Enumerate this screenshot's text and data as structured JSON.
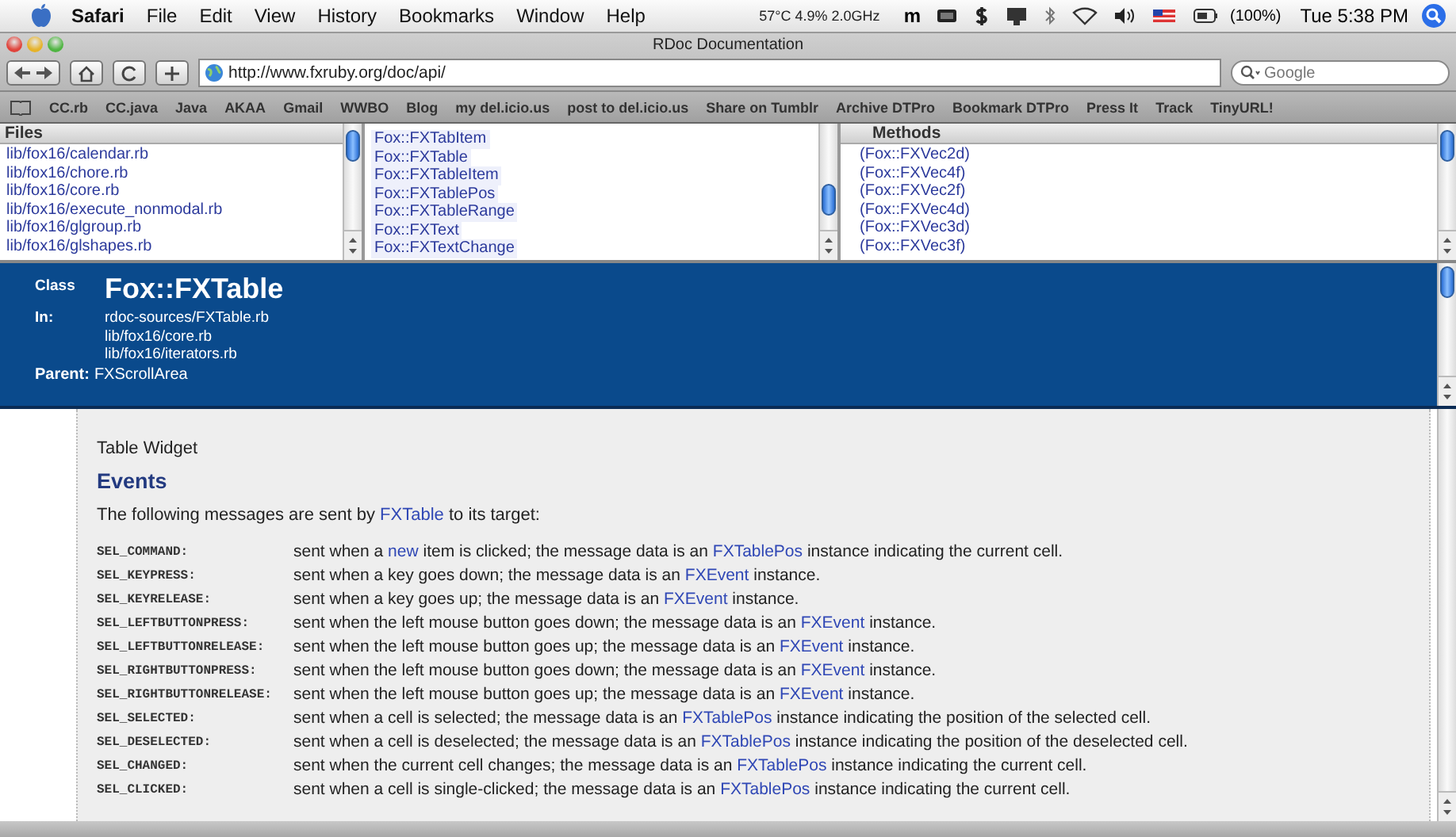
{
  "menubar": {
    "app": "Safari",
    "menus": [
      "File",
      "Edit",
      "View",
      "History",
      "Bookmarks",
      "Window",
      "Help"
    ],
    "status": "57°C 4.9% 2.0GHz",
    "status_letter": "m",
    "battery": "(100%)",
    "clock": "Tue 5:38 PM"
  },
  "window": {
    "title": "RDoc Documentation"
  },
  "toolbar": {
    "url": "http://www.fxruby.org/doc/api/",
    "search": {
      "placeholder": "Google"
    }
  },
  "bookmarks": [
    "CC.rb",
    "CC.java",
    "Java",
    "AKAA",
    "Gmail",
    "WWBO",
    "Blog",
    "my del.icio.us",
    "post to del.icio.us",
    "Share on Tumblr",
    "Archive DTPro",
    "Bookmark DTPro",
    "Press It",
    "Track",
    "TinyURL!"
  ],
  "files": {
    "title": "Files",
    "items": [
      "lib/fox16/calendar.rb",
      "lib/fox16/chore.rb",
      "lib/fox16/core.rb",
      "lib/fox16/execute_nonmodal.rb",
      "lib/fox16/glgroup.rb",
      "lib/fox16/glshapes.rb"
    ]
  },
  "classes": {
    "items": [
      "Fox::FXTabItem",
      "Fox::FXTable",
      "Fox::FXTableItem",
      "Fox::FXTablePos",
      "Fox::FXTableRange",
      "Fox::FXText",
      "Fox::FXTextChange"
    ]
  },
  "methods": {
    "title": "Methods",
    "items": [
      "(Fox::FXVec2d)",
      "(Fox::FXVec4f)",
      "(Fox::FXVec2f)",
      "(Fox::FXVec4d)",
      "(Fox::FXVec3d)",
      "(Fox::FXVec3f)"
    ]
  },
  "class_header": {
    "label": "Class",
    "name": "Fox::FXTable",
    "in_label": "In:",
    "in_files": [
      "rdoc-sources/FXTable.rb",
      "lib/fox16/core.rb",
      "lib/fox16/iterators.rb"
    ],
    "parent_label": "Parent:",
    "parent": "FXScrollArea"
  },
  "content": {
    "description": "Table Widget",
    "heading": "Events",
    "intro": [
      {
        "kind": "text",
        "text": "The following messages are sent by "
      },
      {
        "kind": "link",
        "text": "FXTable"
      },
      {
        "kind": "text",
        "text": " to its target:"
      }
    ],
    "events": [
      {
        "name": "SEL_COMMAND:",
        "description": [
          {
            "kind": "text",
            "text": "sent when a "
          },
          {
            "kind": "link",
            "text": "new"
          },
          {
            "kind": "text",
            "text": " item is clicked; the message data is an "
          },
          {
            "kind": "link",
            "text": "FXTablePos"
          },
          {
            "kind": "text",
            "text": " instance indicating the current cell."
          }
        ]
      },
      {
        "name": "SEL_KEYPRESS:",
        "description": [
          {
            "kind": "text",
            "text": "sent when a key goes down; the message data is an "
          },
          {
            "kind": "link",
            "text": "FXEvent"
          },
          {
            "kind": "text",
            "text": " instance."
          }
        ]
      },
      {
        "name": "SEL_KEYRELEASE:",
        "description": [
          {
            "kind": "text",
            "text": "sent when a key goes up; the message data is an "
          },
          {
            "kind": "link",
            "text": "FXEvent"
          },
          {
            "kind": "text",
            "text": " instance."
          }
        ]
      },
      {
        "name": "SEL_LEFTBUTTONPRESS:",
        "description": [
          {
            "kind": "text",
            "text": "sent when the left mouse button goes down; the message data is an "
          },
          {
            "kind": "link",
            "text": "FXEvent"
          },
          {
            "kind": "text",
            "text": " instance."
          }
        ]
      },
      {
        "name": "SEL_LEFTBUTTONRELEASE:",
        "description": [
          {
            "kind": "text",
            "text": "sent when the left mouse button goes up; the message data is an "
          },
          {
            "kind": "link",
            "text": "FXEvent"
          },
          {
            "kind": "text",
            "text": " instance."
          }
        ]
      },
      {
        "name": "SEL_RIGHTBUTTONPRESS:",
        "description": [
          {
            "kind": "text",
            "text": "sent when the left mouse button goes down; the message data is an "
          },
          {
            "kind": "link",
            "text": "FXEvent"
          },
          {
            "kind": "text",
            "text": " instance."
          }
        ]
      },
      {
        "name": "SEL_RIGHTBUTTONRELEASE:",
        "description": [
          {
            "kind": "text",
            "text": "sent when the left mouse button goes up; the message data is an "
          },
          {
            "kind": "link",
            "text": "FXEvent"
          },
          {
            "kind": "text",
            "text": " instance."
          }
        ]
      },
      {
        "name": "SEL_SELECTED:",
        "description": [
          {
            "kind": "text",
            "text": "sent when a cell is selected; the message data is an "
          },
          {
            "kind": "link",
            "text": "FXTablePos"
          },
          {
            "kind": "text",
            "text": " instance indicating the position of the selected cell."
          }
        ]
      },
      {
        "name": "SEL_DESELECTED:",
        "description": [
          {
            "kind": "text",
            "text": "sent when a cell is deselected; the message data is an "
          },
          {
            "kind": "link",
            "text": "FXTablePos"
          },
          {
            "kind": "text",
            "text": " instance indicating the position of the deselected cell."
          }
        ]
      },
      {
        "name": "SEL_CHANGED:",
        "description": [
          {
            "kind": "text",
            "text": "sent when the current cell changes; the message data is an "
          },
          {
            "kind": "link",
            "text": "FXTablePos"
          },
          {
            "kind": "text",
            "text": " instance indicating the current cell."
          }
        ]
      },
      {
        "name": "SEL_CLICKED:",
        "description": [
          {
            "kind": "text",
            "text": "sent when a cell is single-clicked; the message data is an "
          },
          {
            "kind": "link",
            "text": "FXTablePos"
          },
          {
            "kind": "text",
            "text": " instance indicating the current cell."
          }
        ]
      }
    ]
  }
}
